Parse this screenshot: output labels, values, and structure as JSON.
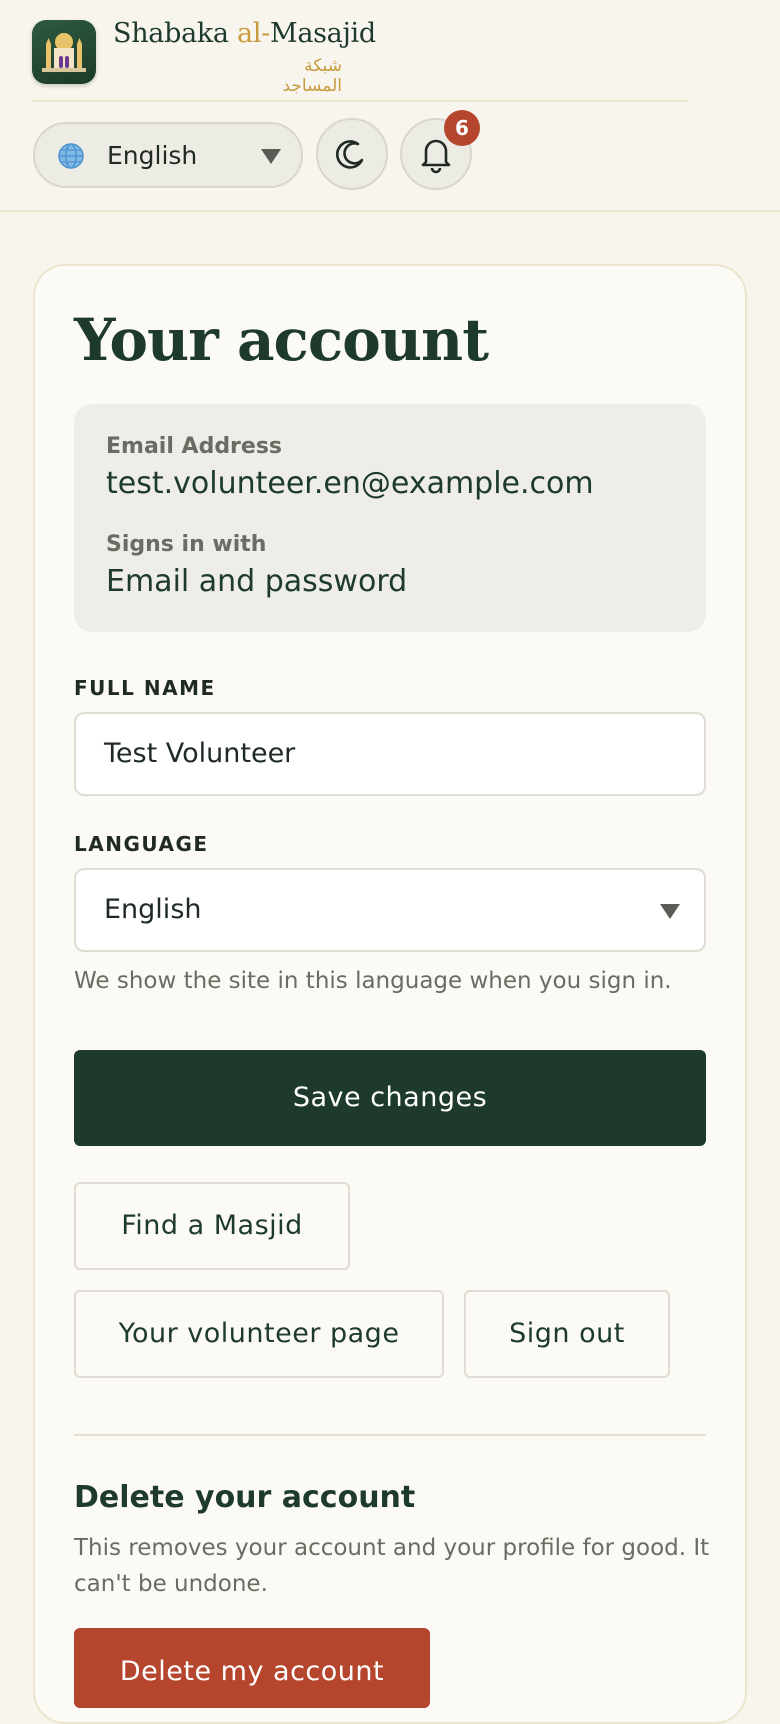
{
  "brand": {
    "name_part1": "Shabaka ",
    "name_part2": "al-",
    "name_part3": "Masajid",
    "arabic": "شبكة المساجد"
  },
  "header": {
    "language_selected": "English",
    "notification_count": "6"
  },
  "page": {
    "title": "Your account"
  },
  "account_info": {
    "email_label": "Email Address",
    "email_value": "test.volunteer.en@example.com",
    "signin_label": "Signs in with",
    "signin_value": "Email and password"
  },
  "form": {
    "full_name_label": "FULL NAME",
    "full_name_value": "Test Volunteer",
    "language_label": "LANGUAGE",
    "language_value": "English",
    "language_help": "We show the site in this language when you sign in.",
    "save_label": "Save changes"
  },
  "links": {
    "find_masjid": "Find a Masjid",
    "volunteer_page": "Your volunteer page",
    "sign_out": "Sign out"
  },
  "delete": {
    "title": "Delete your account",
    "text": "This removes your account and your profile for good. It can't be undone.",
    "button": "Delete my account"
  },
  "colors": {
    "primary": "#1d3a2c",
    "accent_gold": "#c89b3c",
    "danger": "#b5452c",
    "background": "#f8f5ee"
  },
  "icons": {
    "logo": "mosque-icon",
    "language": "globe-icon",
    "theme": "moon-icon",
    "notifications": "bell-icon"
  }
}
